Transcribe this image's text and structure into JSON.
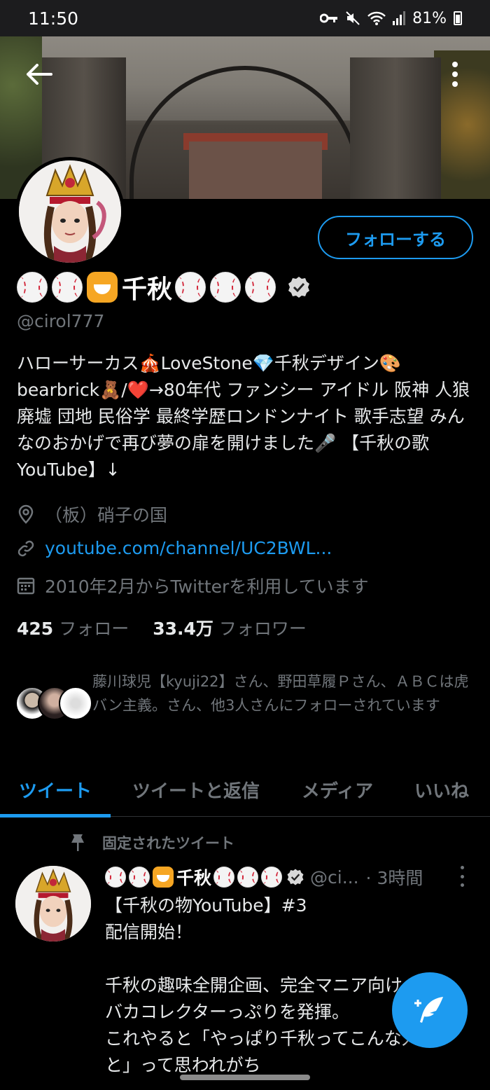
{
  "status_bar": {
    "time": "11:50",
    "battery": "81%"
  },
  "profile": {
    "display_name": "千秋",
    "handle": "@cirol777",
    "follow_label": "フォローする",
    "bio": "ハローサーカス🎪LoveStone💎千秋デザイン🎨bearbrick🧸/❤️→80年代 ファンシー アイドル 阪神 人狼 廃墟 団地 民俗学 最終学歴ロンドンナイト 歌手志望 みんなのおかげで再び夢の扉を開けました🎤 【千秋の歌YouTube】↓",
    "location": "（板）硝子の国",
    "website": "youtube.com/channel/UC2BWL...",
    "joined": "2010年2月からTwitterを利用しています",
    "following_count": "425",
    "following_label": "フォロー",
    "followers_count": "33.4万",
    "followers_label": "フォロワー",
    "followed_by_text": "藤川球児【kyuji22】さん、野田草履Ｐさん、ＡＢＣは虎バン主義。さん、他3人さんにフォローされています"
  },
  "tabs": [
    {
      "label": "ツイート",
      "active": true
    },
    {
      "label": "ツイートと返信",
      "active": false
    },
    {
      "label": "メディア",
      "active": false
    },
    {
      "label": "いいね",
      "active": false
    }
  ],
  "pinned_tweet": {
    "pinned_label": "固定されたツイート",
    "name": "千秋",
    "handle": "@ci...",
    "time": "· 3時間",
    "body": "【千秋の物YouTube】#3\n配信開始！\n\n千秋の趣味全開企画、完全マニア向け\nバカコレクターっぷりを発揮。\nこれやると「やっぱり千秋ってこんな人\nと」って思われがち"
  },
  "colors": {
    "accent": "#1d9bf0",
    "background": "#000000",
    "muted": "#71767b"
  }
}
